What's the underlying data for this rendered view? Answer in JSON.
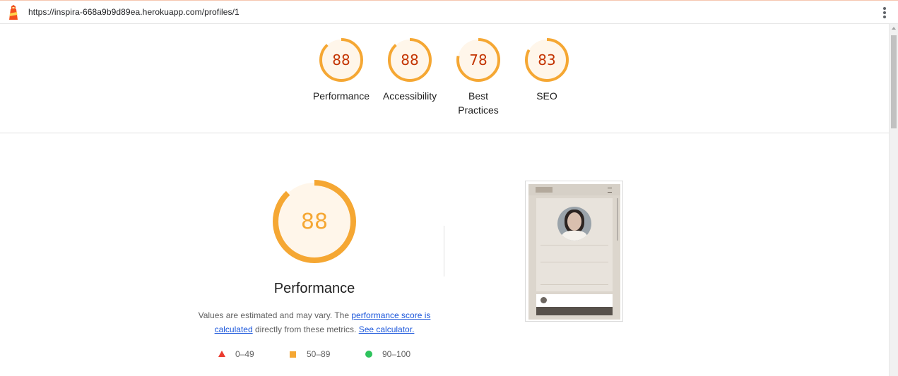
{
  "browser": {
    "url": "https://inspira-668a9b9d89ea.herokuapp.com/profiles/1",
    "logo_icon": "lighthouse-icon",
    "menu_icon": "more-vert-icon"
  },
  "summary": {
    "gauges": [
      {
        "score": "88",
        "value": 88,
        "label": "Performance"
      },
      {
        "score": "88",
        "value": 88,
        "label": "Accessibility"
      },
      {
        "score": "78",
        "value": 78,
        "label": "Best Practices"
      },
      {
        "score": "83",
        "value": 83,
        "label": "SEO"
      }
    ]
  },
  "performance": {
    "score": "88",
    "value": 88,
    "title": "Performance",
    "desc_pre": "Values are estimated and may vary. The ",
    "desc_link1": "performance score is calculated",
    "desc_mid": " directly from these metrics. ",
    "desc_link2": "See calculator."
  },
  "legend": [
    {
      "range": "0–49",
      "shape": "triangle",
      "color": "#eb3b2f"
    },
    {
      "range": "50–89",
      "shape": "square",
      "color": "#f5a733"
    },
    {
      "range": "90–100",
      "shape": "circle",
      "color": "#2ec35d"
    }
  ],
  "colors": {
    "average_fg": "#c33300",
    "average_ring": "#f5a733",
    "average_bg": "#fff6ea"
  }
}
